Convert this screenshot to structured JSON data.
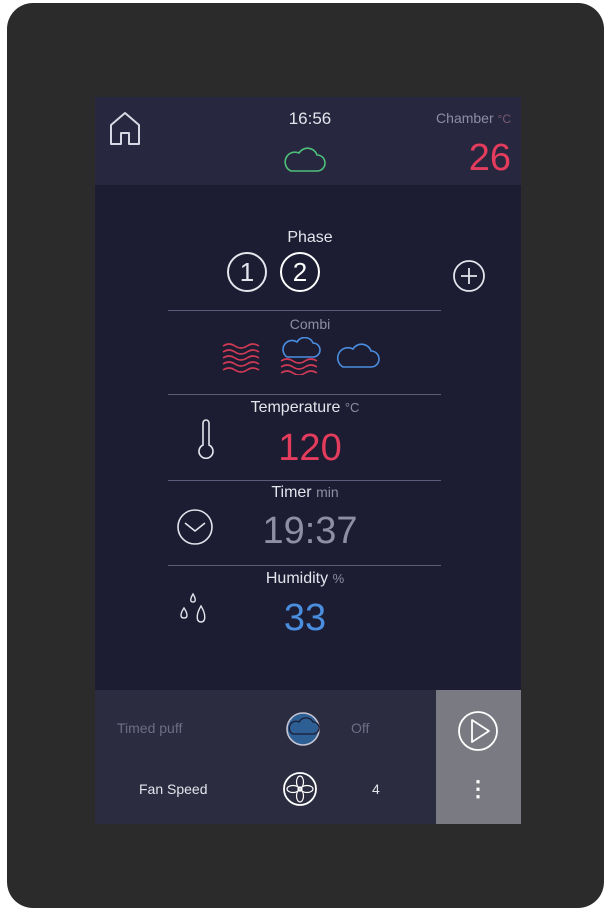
{
  "header": {
    "time": "16:56",
    "chamber_label": "Chamber",
    "chamber_unit": "°C",
    "chamber_value": "26"
  },
  "phase": {
    "label": "Phase",
    "items": [
      "1",
      "2"
    ]
  },
  "mode": {
    "label": "Combi"
  },
  "temperature": {
    "label": "Temperature",
    "unit": "°C",
    "value": "120"
  },
  "timer": {
    "label": "Timer",
    "unit": "min",
    "value": "19:37"
  },
  "humidity": {
    "label": "Humidity",
    "unit": "%",
    "value": "33"
  },
  "bottom": {
    "timed_puff_label": "Timed puff",
    "timed_puff_value": "Off",
    "fan_speed_label": "Fan Speed",
    "fan_speed_value": "4",
    "more_label": "⋮"
  },
  "colors": {
    "accent_red": "#e43c5c",
    "accent_blue": "#4a8ee0",
    "cloud_green": "#4fc07a"
  }
}
